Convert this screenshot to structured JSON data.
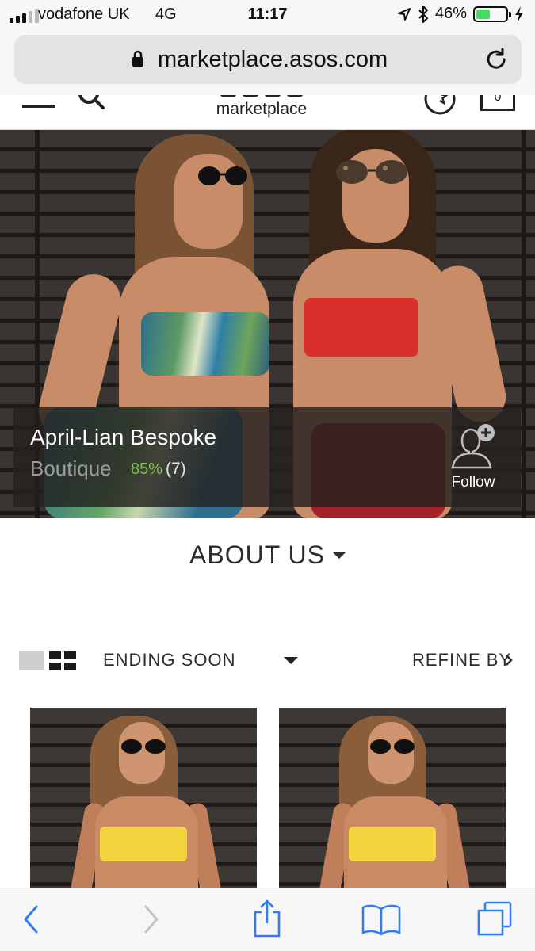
{
  "status_bar": {
    "carrier": "vodafone UK",
    "network": "4G",
    "time": "11:17",
    "battery_percent": "46%",
    "battery_level": 0.46
  },
  "browser": {
    "url": "marketplace.asos.com"
  },
  "site_header": {
    "brand_sub": "marketplace",
    "bag_count": "0"
  },
  "shop": {
    "name": "April-Lian Bespoke",
    "type": "Boutique",
    "rating": "85%",
    "review_count": "(7)",
    "follow_label": "Follow"
  },
  "about": {
    "label": "ABOUT US"
  },
  "toolbar": {
    "sort_label": "ENDING SOON",
    "refine_label": "REFINE BY"
  },
  "products": [
    {
      "name": "product-1",
      "bikini_color": "#f2d53c"
    },
    {
      "name": "product-2",
      "bikini_color": "#f2d53c"
    }
  ],
  "colors": {
    "rating_green": "#7cc34c",
    "ios_blue": "#2f7cf6",
    "battery_green": "#4cd964"
  },
  "icons": [
    "signal-icon",
    "location-icon",
    "bluetooth-icon",
    "battery-icon",
    "charging-icon",
    "lock-icon",
    "reload-icon",
    "hamburger-icon",
    "search-icon",
    "saved-items-icon",
    "bag-icon",
    "follow-person-icon",
    "list-view-icon",
    "grid-view-icon",
    "back-icon",
    "forward-icon",
    "share-icon",
    "bookmarks-icon",
    "tabs-icon"
  ]
}
